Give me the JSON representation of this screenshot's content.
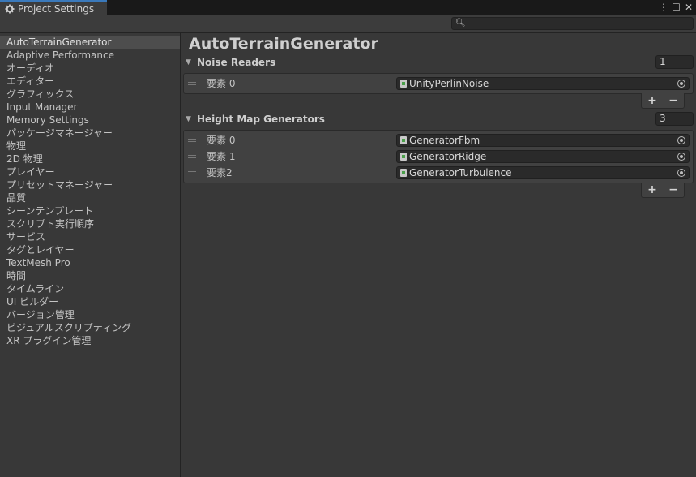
{
  "window": {
    "tab_title": "Project Settings",
    "controls": [
      "⋮",
      "☐",
      "✕"
    ]
  },
  "search": {
    "placeholder": "",
    "value": ""
  },
  "sidebar": {
    "items": [
      "AutoTerrainGenerator",
      "Adaptive Performance",
      "オーディオ",
      "エディター",
      "グラフィックス",
      "Input Manager",
      "Memory Settings",
      "パッケージマネージャー",
      "物理",
      "2D 物理",
      "プレイヤー",
      "プリセットマネージャー",
      "品質",
      "シーンテンプレート",
      "スクリプト実行順序",
      "サービス",
      "タグとレイヤー",
      "TextMesh Pro",
      "時間",
      "タイムライン",
      "UI ビルダー",
      "バージョン管理",
      "ビジュアルスクリプティング",
      "XR プラグイン管理"
    ],
    "selected": "AutoTerrainGenerator"
  },
  "main": {
    "title": "AutoTerrainGenerator",
    "noise_readers": {
      "label": "Noise Readers",
      "count": "1",
      "elements": [
        {
          "label": "要素 0",
          "value": "UnityPerlinNoise"
        }
      ]
    },
    "height_map_generators": {
      "label": "Height Map Generators",
      "count": "3",
      "elements": [
        {
          "label": "要素 0",
          "value": "GeneratorFbm"
        },
        {
          "label": "要素 1",
          "value": "GeneratorRidge"
        },
        {
          "label": "要素2",
          "value": "GeneratorTurbulence"
        }
      ]
    },
    "add_label": "+",
    "remove_label": "−"
  },
  "colors": {
    "background": "#383838",
    "tab_accent": "#3a79bb",
    "field_bg": "#2a2a2a",
    "selected_item": "#4d4d4d"
  },
  "icons": {
    "tab": "gear-icon",
    "search": "search-icon",
    "list_handle": "drag-handle-icon",
    "object": "script-icon",
    "picker": "object-picker-icon"
  }
}
